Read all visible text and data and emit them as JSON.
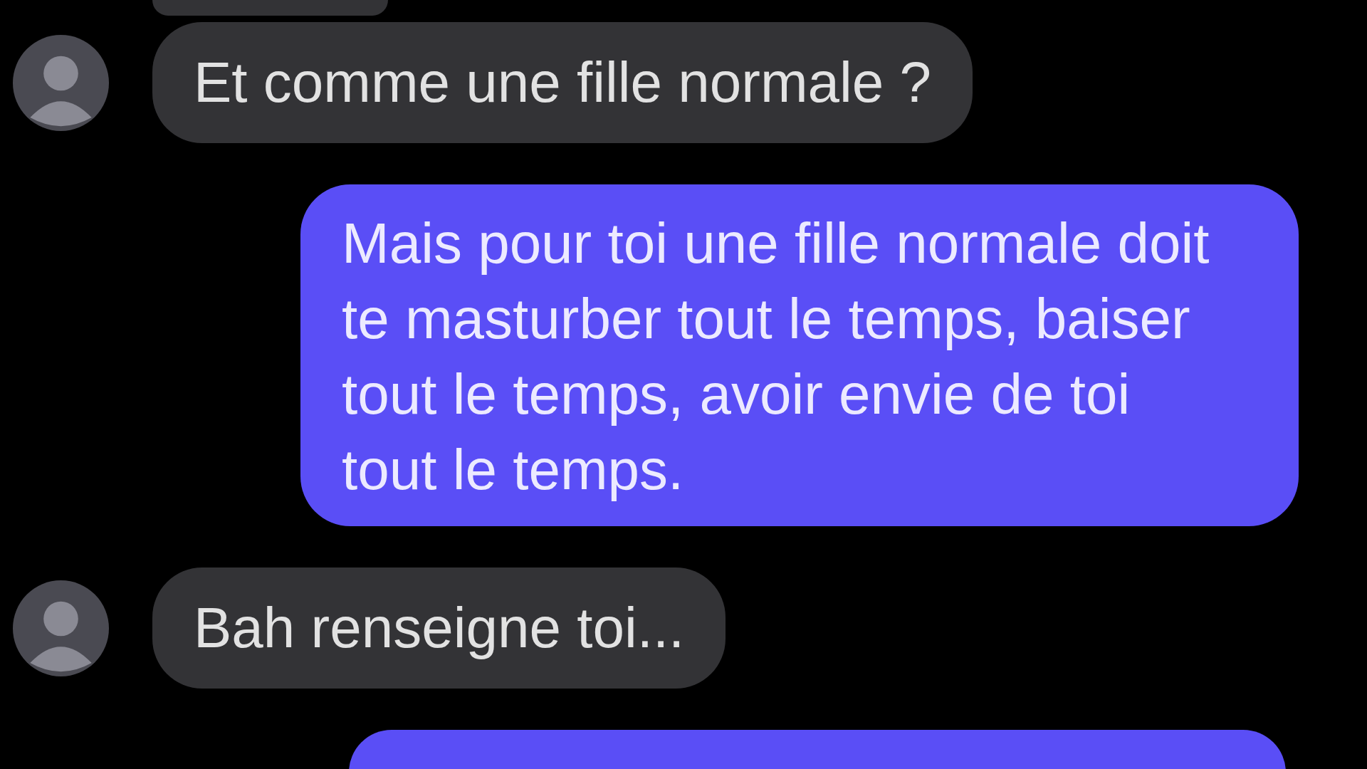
{
  "messages": [
    {
      "kind": "received",
      "avatar": false,
      "partial": true
    },
    {
      "kind": "received",
      "avatar": true,
      "partial": false,
      "text": "Et comme une fille normale ?"
    },
    {
      "kind": "sent",
      "partial": false,
      "text": "Mais pour toi une fille normale doit te masturber tout le temps, baiser tout le temps, avoir envie de toi tout le temps."
    },
    {
      "kind": "received",
      "avatar": true,
      "partial": false,
      "text": "Bah renseigne toi..."
    },
    {
      "kind": "sent",
      "partial": true
    }
  ]
}
